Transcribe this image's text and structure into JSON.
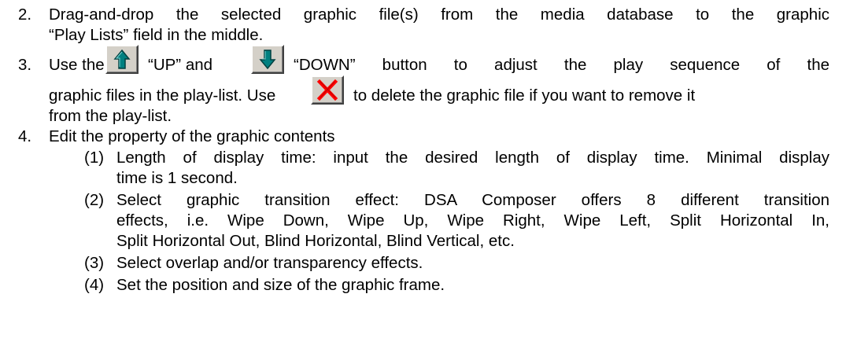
{
  "items": {
    "item2": {
      "number": "2.",
      "line1": "Drag-and-drop the selected graphic file(s) from the media database to the graphic",
      "line2": "“Play Lists” field in the middle."
    },
    "item3": {
      "number": "3.",
      "use_the": "Use the",
      "up_text": "“UP” and",
      "down_text": "“DOWN” button to adjust the play sequence of the",
      "line2_start": "graphic files in the play-list. Use",
      "line2_end": "to delete the graphic file if you want to remove it",
      "line3": "from the play-list."
    },
    "item4": {
      "number": "4.",
      "line1": "Edit the property of the graphic contents",
      "sub1": {
        "number": "(1)",
        "line1": "Length of display time: input the desired length of display time. Minimal display",
        "line2": "time is 1 second."
      },
      "sub2": {
        "number": "(2)",
        "line1": "Select graphic transition effect: DSA Composer offers 8 different transition",
        "line2": "effects, i.e. Wipe Down, Wipe Up, Wipe Right, Wipe Left, Split Horizontal In,",
        "line3": "Split Horizontal Out, Blind Horizontal, Blind Vertical, etc."
      },
      "sub3": {
        "number": "(3)",
        "line1": "Select overlap and/or transparency effects."
      },
      "sub4": {
        "number": "(4)",
        "line1": "Set the position and size of the graphic frame."
      }
    }
  },
  "icons": {
    "up_arrow_color": "#008080",
    "down_arrow_color": "#008080",
    "delete_color": "#ff0000",
    "button_face": "#d4d0c8"
  }
}
